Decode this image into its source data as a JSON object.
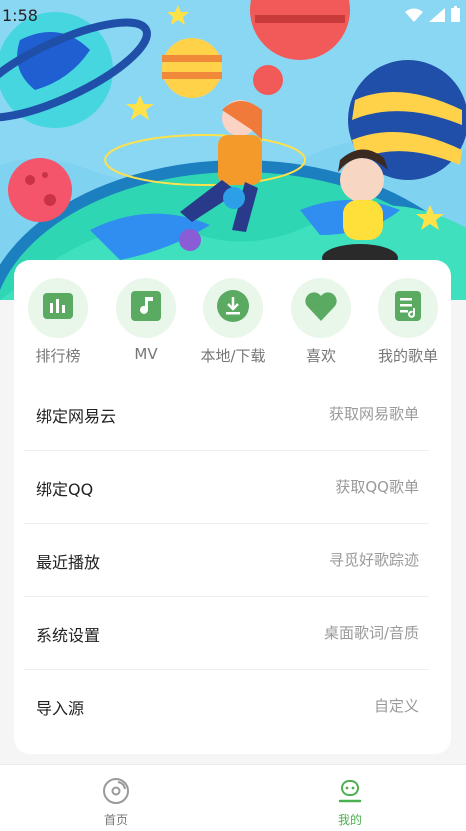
{
  "status_bar": {
    "time": "1:58"
  },
  "quick_actions": [
    {
      "label": "排行榜",
      "icon": "chart-bars-icon"
    },
    {
      "label": "MV",
      "icon": "music-note-icon"
    },
    {
      "label": "本地/下载",
      "icon": "download-icon"
    },
    {
      "label": "喜欢",
      "icon": "heart-icon"
    },
    {
      "label": "我的歌单",
      "icon": "playlist-icon"
    }
  ],
  "menu": [
    {
      "label": "绑定网易云",
      "hint": "获取网易歌单"
    },
    {
      "label": "绑定QQ",
      "hint": "获取QQ歌单"
    },
    {
      "label": "最近播放",
      "hint": "寻觅好歌踪迹"
    },
    {
      "label": "系统设置",
      "hint": "桌面歌词/音质"
    },
    {
      "label": "导入源",
      "hint": "自定义"
    }
  ],
  "tabs": [
    {
      "label": "首页",
      "active": false
    },
    {
      "label": "我的",
      "active": true
    }
  ],
  "colors": {
    "accent": "#4caf50",
    "icon_bg": "#e9f6ea",
    "inactive": "#777777"
  }
}
